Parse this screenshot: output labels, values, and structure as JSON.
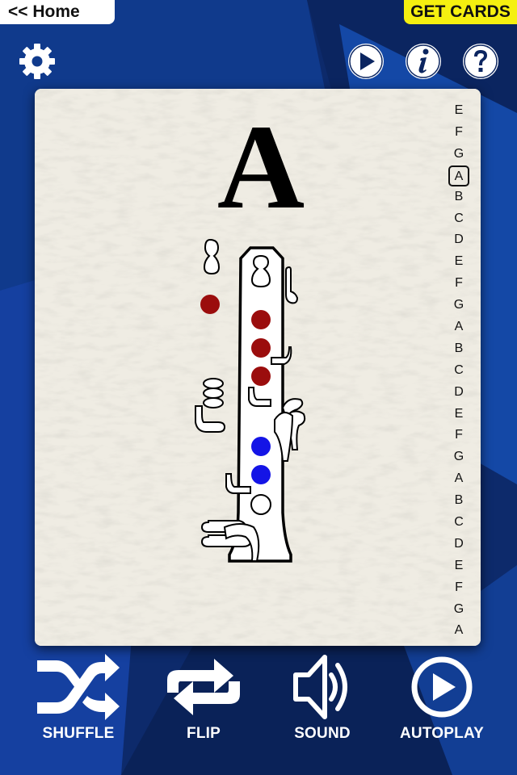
{
  "header": {
    "home_label": "<< Home",
    "get_cards_label": "GET CARDS"
  },
  "toolbar": {
    "icons": [
      "gear-icon",
      "play-icon",
      "info-icon",
      "help-icon"
    ]
  },
  "card": {
    "note": "A",
    "instrument": "clarinet",
    "scale_notes": [
      "E",
      "F",
      "G",
      "A",
      "B",
      "C",
      "D",
      "E",
      "F",
      "G",
      "A",
      "B",
      "C",
      "D",
      "E",
      "F",
      "G",
      "A",
      "B",
      "C",
      "D",
      "E",
      "F",
      "G",
      "A"
    ],
    "active_index": 3,
    "fingering": {
      "closed_color_left": "#9b0d0d",
      "closed_color_right": "#1414e6",
      "thumb_hole": "closed",
      "left_hand_holes": [
        "closed",
        "closed",
        "closed"
      ],
      "right_hand_holes": [
        "closed",
        "closed",
        "open"
      ]
    }
  },
  "bottom_bar": {
    "items": [
      {
        "label": "SHUFFLE",
        "icon": "shuffle-icon"
      },
      {
        "label": "FLIP",
        "icon": "flip-icon"
      },
      {
        "label": "SOUND",
        "icon": "sound-icon"
      },
      {
        "label": "AUTOPLAY",
        "icon": "autoplay-icon"
      }
    ]
  },
  "colors": {
    "background": "#0d2a6b",
    "accent_yellow": "#f5f010",
    "card": "#efece3"
  }
}
